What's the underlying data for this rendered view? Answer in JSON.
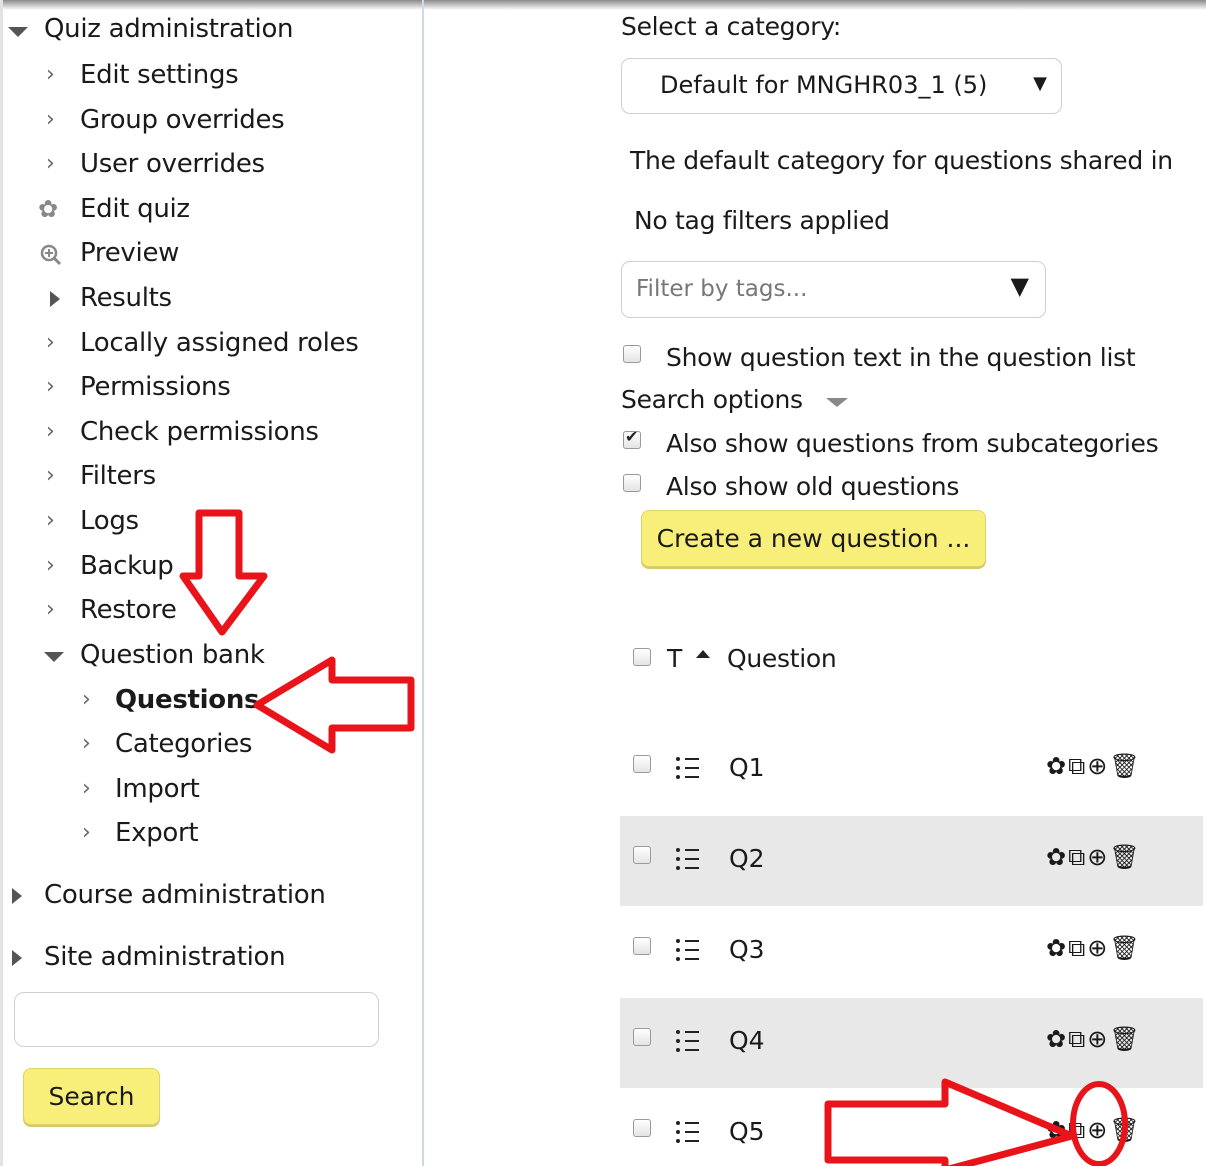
{
  "sidebar": {
    "quiz_admin": "Quiz administration",
    "items": [
      {
        "label": "Edit settings"
      },
      {
        "label": "Group overrides"
      },
      {
        "label": "User overrides"
      },
      {
        "label": "Edit quiz"
      },
      {
        "label": "Preview"
      },
      {
        "label": "Results"
      },
      {
        "label": "Locally assigned roles"
      },
      {
        "label": "Permissions"
      },
      {
        "label": "Check permissions"
      },
      {
        "label": "Filters"
      },
      {
        "label": "Logs"
      },
      {
        "label": "Backup"
      },
      {
        "label": "Restore"
      },
      {
        "label": "Question bank"
      }
    ],
    "qbank_items": [
      {
        "label": "Questions"
      },
      {
        "label": "Categories"
      },
      {
        "label": "Import"
      },
      {
        "label": "Export"
      }
    ],
    "course_admin": "Course administration",
    "site_admin": "Site administration",
    "search_value": "",
    "search_button": "Search"
  },
  "main": {
    "select_label": "Select a category:",
    "category_value": "Default for MNGHR03_1 (5)",
    "category_desc": "The default category for questions shared in",
    "tag_status": "No tag filters applied",
    "tag_placeholder": "Filter by tags...",
    "show_text_label": "Show question text in the question list",
    "search_options": "Search options",
    "subcat_label": "Also show questions from subcategories",
    "old_label": "Also show old questions",
    "create_button": "Create a new question ...",
    "col_type": "T",
    "col_question": "Question",
    "questions": [
      "Q1",
      "Q2",
      "Q3",
      "Q4",
      "Q5"
    ]
  },
  "colors": {
    "button_yellow": "#f8ef7a",
    "annotation_red": "#e8141a",
    "row_stripe": "#e8e8e8"
  }
}
